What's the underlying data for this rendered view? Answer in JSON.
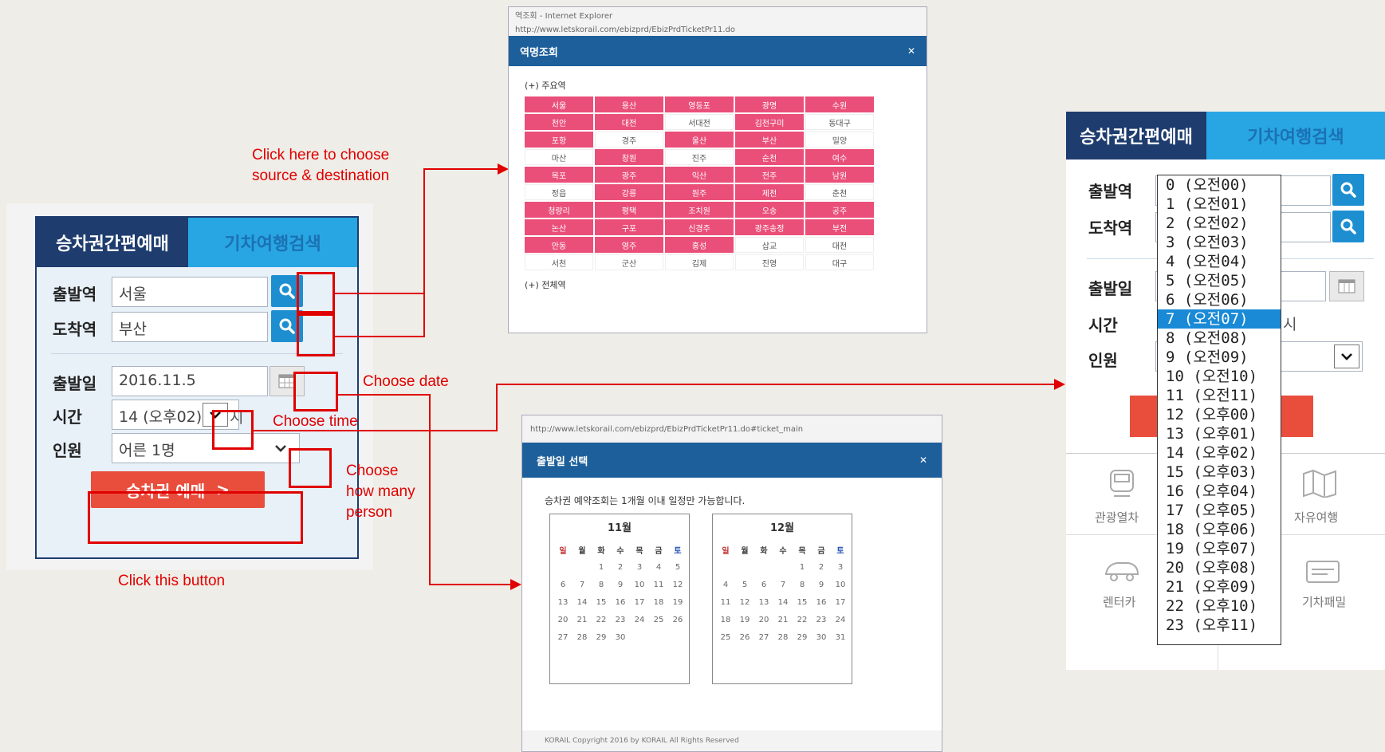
{
  "booking": {
    "tab_active": "승차권간편예매",
    "tab_inactive": "기차여행검색",
    "departure_label": "출발역",
    "departure_value": "서울",
    "arrival_label": "도착역",
    "arrival_value": "부산",
    "date_label": "출발일",
    "date_value": "2016.11.5",
    "time_label": "시간",
    "time_value": "14 (오후02)",
    "time_suffix": "시",
    "people_label": "인원",
    "people_value": "어른 1명",
    "reserve_label": "승차권 예매",
    "reserve_arrow": ">"
  },
  "annotations": {
    "station_note_1": "Click here to choose",
    "station_note_2": "source & destination",
    "date_note": "Choose date",
    "time_note": "Choose time",
    "people_note_1": "Choose",
    "people_note_2": "how many",
    "people_note_3": "person",
    "button_note": "Click this button"
  },
  "station_popup": {
    "chrome_title": "역조회 - Internet Explorer",
    "chrome_url": "http://www.letskorail.com/ebizprd/EbizPrdTicketPr11.do",
    "title": "역명조회",
    "section_major": "(+) 주요역",
    "section_all": "(+) 전체역",
    "stations": [
      "서울",
      "용산",
      "영등포",
      "광명",
      "수원",
      "천안",
      "대전",
      "서대전",
      "김천구미",
      "동대구",
      "포항",
      "경주",
      "울산",
      "부산",
      "밀양",
      "마산",
      "창원",
      "진주",
      "순천",
      "여수",
      "목포",
      "광주",
      "익산",
      "전주",
      "남원",
      "정읍",
      "강릉",
      "원주",
      "제천",
      "춘천",
      "청량리",
      "평택",
      "조치원",
      "오송",
      "공주",
      "논산",
      "구포",
      "신경주",
      "광주송정",
      "부전",
      "안동",
      "영주",
      "홍성",
      "삽교",
      "대천",
      "서천",
      "군산",
      "김제",
      "진영",
      "대구"
    ]
  },
  "calendar_popup": {
    "chrome_url": "http://www.letskorail.com/ebizprd/EbizPrdTicketPr11.do#ticket_main",
    "title": "출발일 선택",
    "notice": "승차권 예약조회는 1개월 이내 일정만 가능합니다.",
    "weekdays": [
      "일",
      "월",
      "화",
      "수",
      "목",
      "금",
      "토"
    ],
    "months": [
      {
        "label": "11월",
        "days": [
          "",
          "",
          "1",
          "2",
          "3",
          "4",
          "5",
          "6",
          "7",
          "8",
          "9",
          "10",
          "11",
          "12",
          "13",
          "14",
          "15",
          "16",
          "17",
          "18",
          "19",
          "20",
          "21",
          "22",
          "23",
          "24",
          "25",
          "26",
          "27",
          "28",
          "29",
          "30",
          "",
          ""
        ]
      },
      {
        "label": "12월",
        "days": [
          "",
          "",
          "",
          "",
          "1",
          "2",
          "3",
          "4",
          "5",
          "6",
          "7",
          "8",
          "9",
          "10",
          "11",
          "12",
          "13",
          "14",
          "15",
          "16",
          "17",
          "18",
          "19",
          "20",
          "21",
          "22",
          "23",
          "24",
          "25",
          "26",
          "27",
          "28",
          "29",
          "30",
          "31"
        ]
      }
    ],
    "footer": "KORAIL Copyright 2016 by KORAIL All Rights Reserved"
  },
  "dropdown_screen": {
    "tab_active": "승차권간편예매",
    "tab_inactive": "기차여행검색",
    "departure_label": "출발역",
    "arrival_label": "도착역",
    "date_label": "출발일",
    "time_label": "시간",
    "time_suffix": "시",
    "people_label": "인원",
    "services": [
      "관광열차",
      "자유여행",
      "렌터카",
      "기차패밀"
    ],
    "time_options": [
      "0 (오전00)",
      "1 (오전01)",
      "2 (오전02)",
      "3 (오전03)",
      "4 (오전04)",
      "5 (오전05)",
      "6 (오전06)",
      "7 (오전07)",
      "8 (오전08)",
      "9 (오전09)",
      "10 (오전10)",
      "11 (오전11)",
      "12 (오후00)",
      "13 (오후01)",
      "14 (오후02)",
      "15 (오후03)",
      "16 (오후04)",
      "17 (오후05)",
      "18 (오후06)",
      "19 (오후07)",
      "20 (오후08)",
      "21 (오후09)",
      "22 (오후10)",
      "23 (오후11)"
    ],
    "selected_index": 7
  },
  "colors": {
    "accent_red": "#e00000",
    "navy": "#1e3c6e",
    "sky": "#28a6e3",
    "station_pink": "#ea4f79",
    "button_red": "#e94e3d"
  }
}
